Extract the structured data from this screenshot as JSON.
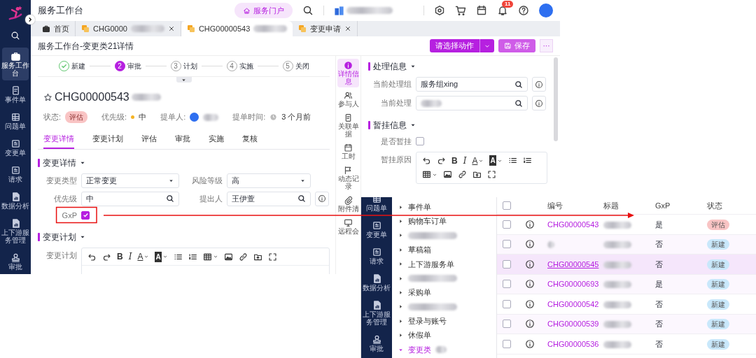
{
  "header": {
    "title": "服务工作台",
    "portal": "服务门户",
    "notifications": "11"
  },
  "nav": [
    {
      "label": "服务工作台",
      "selected": true
    },
    {
      "label": "事件单",
      "selected": false
    },
    {
      "label": "问题单",
      "selected": false
    },
    {
      "label": "变更单",
      "selected": false
    },
    {
      "label": "请求",
      "selected": false
    },
    {
      "label": "数据分析",
      "selected": false
    },
    {
      "label": "上下游服务管理",
      "selected": false
    },
    {
      "label": "审批",
      "selected": false
    }
  ],
  "tabs": [
    {
      "label": "首页",
      "selected": false,
      "closable": false,
      "blurred": false
    },
    {
      "label": "CHG0000",
      "selected": false,
      "closable": true,
      "blurred": true
    },
    {
      "label": "CHG00000543",
      "selected": true,
      "closable": false,
      "blurred": true
    },
    {
      "label": "变更申请",
      "selected": false,
      "closable": true,
      "blurred": false
    }
  ],
  "page_title": "服务工作台-变更类21详情",
  "actions": {
    "select": "请选择动作",
    "save": "保存",
    "more": "···"
  },
  "steps": [
    {
      "label": "新建",
      "done": true
    },
    {
      "number": "2",
      "label": "审批",
      "done": false,
      "selected": true
    },
    {
      "number": "3",
      "label": "计划",
      "done": false,
      "selected": false
    },
    {
      "number": "4",
      "label": "实施",
      "done": false,
      "selected": false
    },
    {
      "number": "5",
      "label": "关闭",
      "done": false,
      "selected": false
    }
  ],
  "record": {
    "id": "CHG00000543",
    "status_label": "状态:",
    "status": "评估",
    "priority_label": "优先级:",
    "priority": "中",
    "submitter_label": "提单人:",
    "time_label": "提单时间:",
    "time": "3 个月前"
  },
  "detail_tabs": [
    {
      "label": "变更详情",
      "selected": true
    },
    {
      "label": "变更计划",
      "selected": false
    },
    {
      "label": "评估",
      "selected": false
    },
    {
      "label": "审批",
      "selected": false
    },
    {
      "label": "实施",
      "selected": false
    },
    {
      "label": "复核",
      "selected": false
    }
  ],
  "change_details": {
    "title": "变更详情",
    "fields": [
      {
        "label": "变更类型",
        "value": "正常变更",
        "kind": "select"
      },
      {
        "label": "风险等级",
        "value": "高",
        "kind": "select"
      },
      {
        "label": "优先级",
        "value": "中",
        "kind": "lookup"
      },
      {
        "label": "提出人",
        "value": "王伊萱",
        "kind": "lookup",
        "info": true
      }
    ],
    "gxp": {
      "label": "GxP",
      "checked": true
    }
  },
  "change_plan": {
    "title": "变更计划",
    "label": "变更计划",
    "toolbar": [
      {
        "kind": "undo"
      },
      {
        "kind": "redo"
      },
      {
        "kind": "bold",
        "glyph": "B"
      },
      {
        "kind": "italic",
        "glyph": "I"
      },
      {
        "kind": "font-color",
        "glyph": "A",
        "dropdown": true
      },
      {
        "kind": "highlight",
        "glyph": "A",
        "dropdown": true
      },
      {
        "kind": "bullet-list"
      },
      {
        "kind": "number-list"
      },
      {
        "kind": "table",
        "dropdown": true
      },
      {
        "kind": "image"
      },
      {
        "kind": "link"
      },
      {
        "kind": "upload"
      },
      {
        "kind": "fullscreen"
      }
    ]
  },
  "side_nav": [
    {
      "label": "详情信息",
      "selected": true
    },
    {
      "label": "参与人",
      "selected": false
    },
    {
      "label": "关联单据",
      "selected": false
    },
    {
      "label": "工时",
      "selected": false
    },
    {
      "label": "动态记录",
      "selected": false
    },
    {
      "label": "附件清",
      "selected": false
    },
    {
      "label": "远程会",
      "selected": false
    }
  ],
  "handling": {
    "title": "处理信息",
    "fields": [
      {
        "label": "当前处理组",
        "value": "服务组xing",
        "blurred": false
      },
      {
        "label": "当前处理",
        "blurred": true
      }
    ]
  },
  "suspend": {
    "title": "暂挂信息",
    "checkbox_label": "是否暂挂",
    "checked": false,
    "reason_label": "暂挂原因",
    "toolbar": [
      {
        "kind": "undo"
      },
      {
        "kind": "redo"
      },
      {
        "kind": "bold",
        "glyph": "B"
      },
      {
        "kind": "italic",
        "glyph": "I"
      },
      {
        "kind": "font-color",
        "glyph": "A",
        "dropdown": true
      },
      {
        "kind": "highlight",
        "glyph": "A",
        "dropdown": true
      },
      {
        "kind": "bullet-list"
      },
      {
        "kind": "number-list"
      },
      {
        "kind": "table",
        "dropdown": true
      },
      {
        "kind": "image"
      },
      {
        "kind": "link"
      },
      {
        "kind": "upload"
      },
      {
        "kind": "fullscreen"
      }
    ]
  },
  "overlay": {
    "nav": [
      {
        "label": "问题单",
        "selected": false
      },
      {
        "label": "变更单",
        "selected": false
      },
      {
        "label": "请求",
        "selected": false
      },
      {
        "label": "数据分析",
        "selected": false
      },
      {
        "label": "上下游服务管理",
        "selected": false
      },
      {
        "label": "审批",
        "selected": false
      }
    ],
    "tree": [
      {
        "label": "事件单",
        "expanded": false
      },
      {
        "label": "购物车订单",
        "expanded": false
      },
      {
        "blurred": true,
        "expanded": false
      },
      {
        "label": "草稿箱",
        "expanded": false
      },
      {
        "label": "上下游服务单",
        "expanded": false
      },
      {
        "blurred": true,
        "expanded": false
      },
      {
        "label": "采购单",
        "expanded": false
      },
      {
        "blurred": true,
        "expanded": false
      },
      {
        "label": "登录与账号",
        "expanded": false
      },
      {
        "label": "休假单",
        "expanded": false
      },
      {
        "label": "变更类",
        "expanded": true
      }
    ],
    "select_all_checked": false,
    "columns": [
      "编号",
      "标题",
      "GxP",
      "状态"
    ],
    "rows": [
      {
        "id": "CHG00000543",
        "gxp": "是",
        "status": {
          "text": "评估",
          "color": "#f9c4c4"
        },
        "checked": false,
        "hovered": false
      },
      {
        "gxp": "否",
        "status": {
          "text": "新建",
          "color": "#c9e8fb"
        },
        "checked": false,
        "hovered": false
      },
      {
        "id": "CHG00000545",
        "gxp": "否",
        "status": {
          "text": "新建",
          "color": "#c9e8fb"
        },
        "checked": false,
        "hovered": true
      },
      {
        "id": "CHG00000693",
        "gxp": "是",
        "status": {
          "text": "新建",
          "color": "#c9e8fb"
        },
        "checked": false,
        "hovered": false
      },
      {
        "id": "CHG00000542",
        "gxp": "否",
        "status": {
          "text": "新建",
          "color": "#c9e8fb"
        },
        "checked": false,
        "hovered": false
      },
      {
        "id": "CHG00000539",
        "gxp": "否",
        "status": {
          "text": "新建",
          "color": "#c9e8fb"
        },
        "checked": false,
        "hovered": false
      },
      {
        "id": "CHG00000536",
        "gxp": "否",
        "status": {
          "text": "新建",
          "color": "#c9e8fb"
        },
        "checked": false,
        "hovered": false
      }
    ]
  }
}
